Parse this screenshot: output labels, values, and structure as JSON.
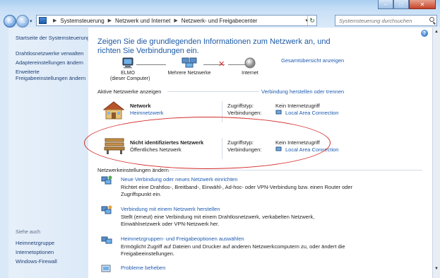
{
  "address_bar": {
    "crumbs": [
      "Systemsteuerung",
      "Netzwerk und Internet",
      "Netzwerk- und Freigabecenter"
    ]
  },
  "search": {
    "placeholder": "Systemsteuerung durchsuchen"
  },
  "left_pane": {
    "home_link": "Startseite der Systemsteuerung",
    "links": [
      "Drahtlosnetzwerke verwalten",
      "Adaptereinstellungen ändern",
      "Erweiterte Freigabeeinstellungen ändern"
    ],
    "see_also_heading": "Siehe auch",
    "see_also": [
      "Heimnetzgruppe",
      "Internetoptionen",
      "Windows-Firewall"
    ]
  },
  "main": {
    "heading": "Zeigen Sie die grundlegenden Informationen zum Netzwerk an, und richten Sie Verbindungen ein.",
    "overview_link": "Gesamtübersicht anzeigen",
    "network_map": {
      "computer_name": "ELMO",
      "computer_sub": "(dieser Computer)",
      "multi": "Mehrere Netzwerke",
      "internet": "Internet"
    },
    "active_networks": {
      "title": "Aktive Netzwerke anzeigen",
      "connect_link": "Verbindung herstellen oder trennen",
      "access_key": "Zugriffstyp:",
      "connections_key": "Verbindungen:",
      "networks": [
        {
          "name": "Network",
          "type": "Heimnetzwerk",
          "access": "Kein Internetzugriff",
          "connection": "Local Area Connection"
        },
        {
          "name": "Nicht identifiziertes Netzwerk",
          "type": "Öffentliches Netzwerk",
          "access": "Kein Internetzugriff",
          "connection": "Local Area Connection"
        }
      ]
    },
    "change_settings": {
      "title": "Netzwerkeinstellungen ändern",
      "tasks": [
        {
          "title": "Neue Verbindung oder neues Netzwerk einrichten",
          "desc": "Richtet eine Drahtlos-, Breitband-, Einwähl-, Ad-hoc- oder VPN-Verbindung bzw. einen Router oder Zugriffspunkt ein."
        },
        {
          "title": "Verbindung mit einem Netzwerk herstellen",
          "desc": "Stellt (erneut) eine Verbindung mit einem Drahtlosnetzwerk, verkabelten Netzwerk, Einwählnetzwerk oder VPN-Netzwerk her."
        },
        {
          "title": "Heimnetzgruppen- und Freigabeoptionen auswählen",
          "desc": "Ermöglicht Zugriff auf Dateien und Drucker auf anderen Netzwerkcomputern zu, oder ändert die Freigabeeinstellungen."
        },
        {
          "title": "Probleme beheben",
          "desc": ""
        }
      ]
    }
  },
  "colors": {
    "link": "#1e5bb0",
    "heading": "#1d5aa6",
    "annotation": "#d42a2a"
  }
}
